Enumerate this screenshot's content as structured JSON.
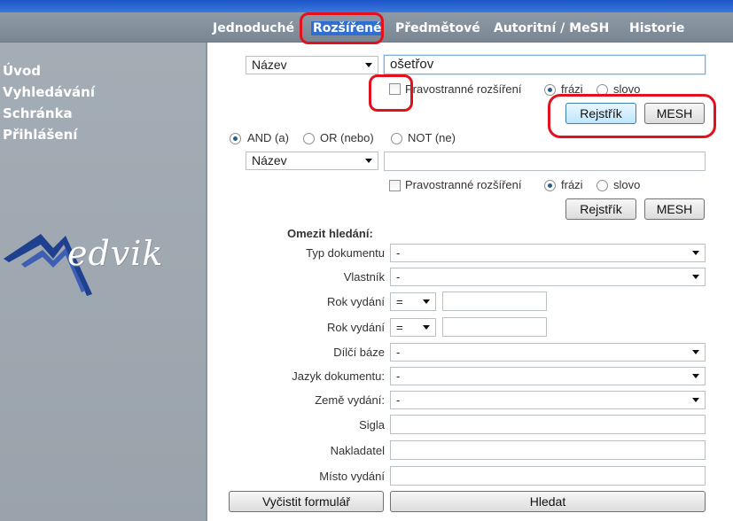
{
  "nav": {
    "tabs": [
      "Jednoduché",
      "Rozšířené",
      "Předmětové",
      "Autoritní / MeSH",
      "Historie"
    ],
    "active": "Rozšířené"
  },
  "sidebar": {
    "items": [
      "Úvod",
      "Vyhledávání",
      "Schránka",
      "Přihlášení"
    ],
    "logo_text": "edvik"
  },
  "query1": {
    "field_select": "Název",
    "value": "ošetřov",
    "truncation_label": "Pravostranné rozšíření",
    "truncation_checked": false,
    "mode_phrase": "frázi",
    "mode_word": "slovo",
    "mode_selected": "frázi",
    "index_button": "Rejstřík",
    "mesh_button": "MESH"
  },
  "operators": {
    "and": "AND (a)",
    "or": "OR (nebo)",
    "not": "NOT (ne)",
    "selected": "AND (a)"
  },
  "query2": {
    "field_select": "Název",
    "value": "",
    "truncation_label": "Pravostranné rozšíření",
    "truncation_checked": false,
    "mode_phrase": "frázi",
    "mode_word": "slovo",
    "mode_selected": "frázi",
    "index_button": "Rejstřík",
    "mesh_button": "MESH"
  },
  "limits": {
    "heading": "Omezit hledání:",
    "doc_type_label": "Typ dokumentu",
    "doc_type_value": "-",
    "owner_label": "Vlastník",
    "owner_value": "-",
    "year1_label": "Rok vydání",
    "year1_op": "=",
    "year1_value": "",
    "year2_label": "Rok vydání",
    "year2_op": "=",
    "year2_value": "",
    "subbase_label": "Dílčí báze",
    "subbase_value": "-",
    "language_label": "Jazyk dokumentu:",
    "language_value": "-",
    "country_label": "Země vydání:",
    "country_value": "-",
    "sigla_label": "Sigla",
    "sigla_value": "",
    "publisher_label": "Nakladatel",
    "publisher_value": "",
    "place_label": "Místo vydání",
    "place_value": ""
  },
  "actions": {
    "clear": "Vyčistit formulář",
    "search": "Hledat"
  },
  "colors": {
    "navbar": "#8e9aa6",
    "sidebar": "#a4adb5",
    "active_tab": "#2f6fd3",
    "annotation": "#e3101e"
  }
}
